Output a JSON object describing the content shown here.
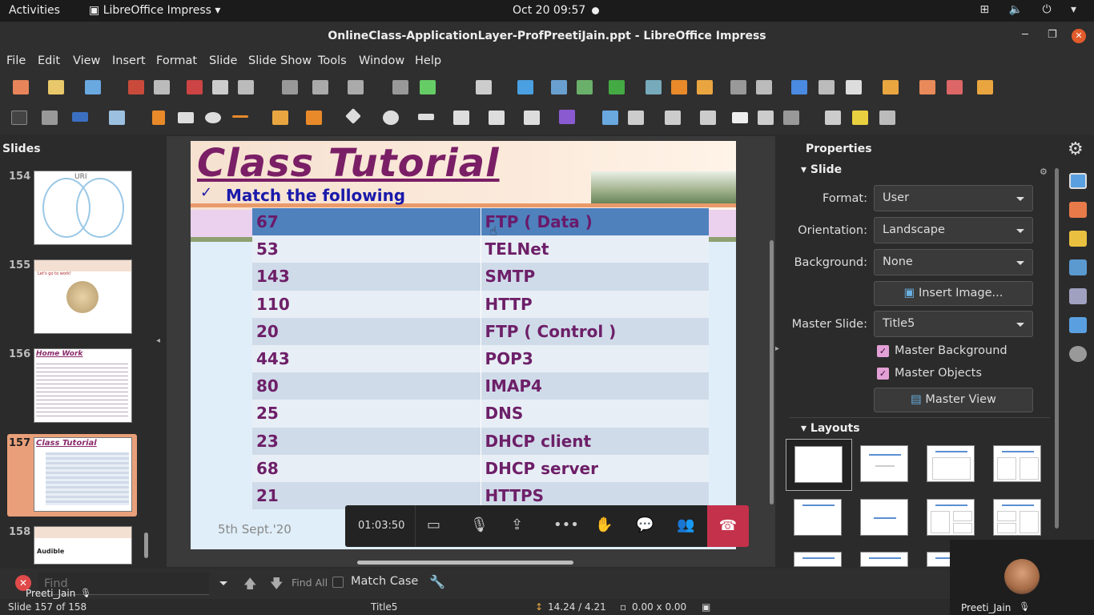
{
  "gnome": {
    "activities": "Activities",
    "app_menu": "LibreOffice Impress",
    "clock": "Oct 20  09:57",
    "sys_icons": [
      "network-icon",
      "volume-icon",
      "power-icon"
    ]
  },
  "window": {
    "title": "OnlineClass-ApplicationLayer-ProfPreetiJain.ppt - LibreOffice Impress"
  },
  "menu": [
    "File",
    "Edit",
    "View",
    "Insert",
    "Format",
    "Slide",
    "Slide Show",
    "Tools",
    "Window",
    "Help"
  ],
  "slides_pane": {
    "header": "Slides",
    "thumbs": [
      {
        "num": "154",
        "title": "URI"
      },
      {
        "num": "155",
        "title": "Let's go to work!"
      },
      {
        "num": "156",
        "title": "Home Work"
      },
      {
        "num": "157",
        "title": "Class Tutorial"
      },
      {
        "num": "158",
        "title": "Audible"
      }
    ]
  },
  "slide": {
    "title": "Class Tutorial",
    "subtitle": "Match the following",
    "date": "5th Sept.'20",
    "rows": [
      {
        "a": "67",
        "b": "FTP ( Data )"
      },
      {
        "a": "53",
        "b": "TELNet"
      },
      {
        "a": "143",
        "b": "SMTP"
      },
      {
        "a": "110",
        "b": "HTTP"
      },
      {
        "a": "20",
        "b": "FTP ( Control )"
      },
      {
        "a": "443",
        "b": "POP3"
      },
      {
        "a": "80",
        "b": "IMAP4"
      },
      {
        "a": "25",
        "b": "DNS"
      },
      {
        "a": "23",
        "b": "DHCP client"
      },
      {
        "a": "68",
        "b": "DHCP server"
      },
      {
        "a": "21",
        "b": "HTTPS"
      }
    ]
  },
  "call": {
    "timer": "01:03:50"
  },
  "properties": {
    "title": "Properties",
    "slide_section": "Slide",
    "format_label": "Format:",
    "format_value": "User",
    "orientation_label": "Orientation:",
    "orientation_value": "Landscape",
    "background_label": "Background:",
    "background_value": "None",
    "insert_image": "Insert Image...",
    "master_slide_label": "Master Slide:",
    "master_slide_value": "Title5",
    "master_background": "Master Background",
    "master_objects": "Master Objects",
    "master_view": "Master View",
    "layouts_section": "Layouts"
  },
  "find_bar": {
    "placeholder": "Find",
    "find_all": "Find All",
    "match_case": "Match Case"
  },
  "status": {
    "slide_info": "Slide 157 of 158",
    "master": "Title5",
    "position": "14.24 / 4.21",
    "size": "0.00 x 0.00",
    "presenter_left": "Preeti_Jain",
    "presenter_right": "Preeti_Jain"
  },
  "colors": {
    "title_purple": "#7a1f66",
    "subtitle_blue": "#1a1aaa",
    "highlight_row": "#4f81bd",
    "end_call": "#c4314b"
  }
}
